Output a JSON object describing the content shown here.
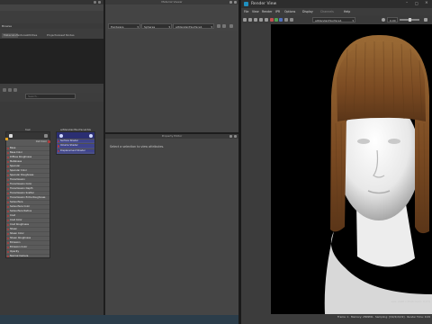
{
  "hypershade": {
    "tabs": [
      "Browse",
      "Materials",
      "Textures",
      "Utilities",
      "Rendering",
      "Lights",
      "Cameras",
      "Shading Groups",
      "Bake Sets",
      "Projects",
      "Asset Nodes"
    ],
    "search_placeholder": "Search..."
  },
  "material_viewer": {
    "title": "Material Viewer",
    "renderer": "Hardware",
    "object": "Spheres",
    "material": "aiStandardSurface1"
  },
  "property_editor": {
    "title": "Property Editor",
    "message": "Select a selection to view attributes."
  },
  "shader_node": {
    "title": "hair",
    "header_icon": "surface-shader-icon",
    "out_label": "Out Color",
    "attributes": [
      "Base",
      "Base Color",
      "Diffuse Roughness",
      "Metalness",
      "Specular",
      "Specular Color",
      "Specular Roughness",
      "Transmission",
      "Transmission Color",
      "Transmission Depth",
      "Transmission Scatter",
      "Transmission Extra Roughness",
      "Subsurface",
      "Subsurface Color",
      "Subsurface Radius",
      "Coat",
      "Coat Color",
      "Coat Roughness",
      "Sheen",
      "Sheen Color",
      "Sheen Roughness",
      "Emission",
      "Emission Color",
      "Opacity",
      "Normal Camera"
    ]
  },
  "sg_node": {
    "title": "aiStandardSurface1SG",
    "attributes": [
      "Surface Shader",
      "Volume Shader",
      "Displacement Shader"
    ]
  },
  "render_view": {
    "title": "Render View",
    "menus": [
      "File",
      "View",
      "Render",
      "IPR",
      "Options",
      "Display",
      "Channels",
      "Help"
    ],
    "camera_select": "aiStandardSurface1",
    "exposure_value": "0.00",
    "status_size": "size: 2048 x 2048 zoom: 0.171",
    "status_frame": "Frame: 1",
    "status_memory": "Memory: 2809Mb",
    "status_sampling": "Sampling: [3/2/2/2/2/2]",
    "status_render_time": "Render Time: 0:29"
  },
  "colors": {
    "panel_bg": "#444444",
    "render_bg": "#000000",
    "node_header": "#3b4a5e",
    "sg_header": "#2b2f72",
    "port_red": "#b23b3b",
    "hair_brown": "#8a5a2b"
  }
}
